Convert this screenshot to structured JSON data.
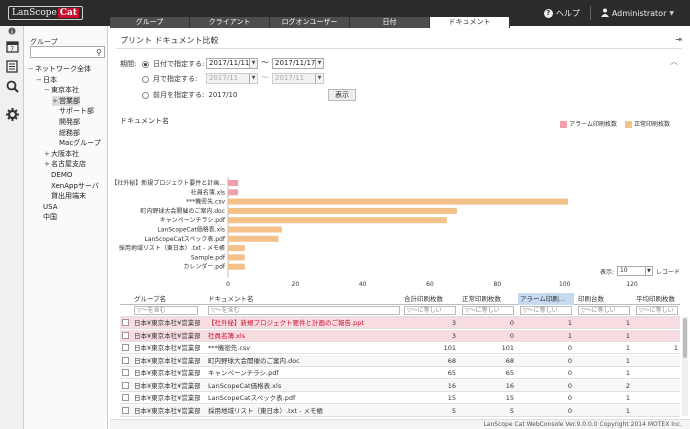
{
  "app": {
    "logo_main": "LanScope",
    "logo_accent": "Cat"
  },
  "topnav": {
    "help": "ヘルプ",
    "user": "Administrator"
  },
  "tabs": [
    "グループ",
    "クライアント",
    "ログオンユーザー",
    "日付",
    "ドキュメント"
  ],
  "active_tab": 4,
  "group_panel": {
    "title": "グループ",
    "tree": [
      {
        "label": "ネットワーク全体",
        "toggle": "−",
        "level": 0
      },
      {
        "label": "日本",
        "toggle": "−",
        "level": 1
      },
      {
        "label": "東京本社",
        "toggle": "−",
        "level": 2
      },
      {
        "label": "営業部",
        "toggle": "+",
        "level": 3,
        "selected": true
      },
      {
        "label": "サポート部",
        "toggle": "",
        "level": 3
      },
      {
        "label": "開発部",
        "toggle": "",
        "level": 3
      },
      {
        "label": "総務部",
        "toggle": "",
        "level": 3
      },
      {
        "label": "Macグループ",
        "toggle": "",
        "level": 3
      },
      {
        "label": "大阪本社",
        "toggle": "+",
        "level": 2
      },
      {
        "label": "名古屋支店",
        "toggle": "+",
        "level": 2
      },
      {
        "label": "DEMO",
        "toggle": "",
        "level": 2
      },
      {
        "label": "XenAppサーバ",
        "toggle": "",
        "level": 2
      },
      {
        "label": "貸出用端末",
        "toggle": "",
        "level": 2
      },
      {
        "label": "USA",
        "toggle": "",
        "level": 1
      },
      {
        "label": "中国",
        "toggle": "",
        "level": 1
      }
    ]
  },
  "main": {
    "title": "プリント ドキュメント比較",
    "period_label": "期間:",
    "opt_date": "日付で指定する:",
    "opt_month": "月で指定する:",
    "opt_prev_month": "前月を指定する:",
    "date_from": "2017/11/11",
    "date_to": "2017/11/17",
    "month_from": "2017/11",
    "month_to": "2017/11",
    "prev_month": "2017/10",
    "display_button": "表示",
    "doc_label": "ドキュメント名",
    "legend_alarm": "アラーム印刷枚数",
    "legend_normal": "正常印刷枚数",
    "page_display_label": "表示:",
    "page_size": "10",
    "record_label": "レコード"
  },
  "colors": {
    "alarm": "#f0a0aa",
    "normal": "#f3c28a",
    "active_tab": "#ffffff"
  },
  "chart_data": {
    "type": "bar",
    "orientation": "horizontal",
    "stacked": true,
    "categories": [
      "【社外秘】新規プロジェクト要件と計画...",
      "社員名簿.xls",
      "***機密先.csv",
      "町内野球大会開催のご案内.doc",
      "キャンペーンチラシ.pdf",
      "LanScopeCat価格表.xls",
      "LanScopeCatスペック表.pdf",
      "採用地域リスト（東日本）.txt - メモ帳",
      "Sample.pdf",
      "カレンダー.pdf"
    ],
    "series": [
      {
        "name": "アラーム印刷枚数",
        "values": [
          3,
          3,
          0,
          0,
          0,
          0,
          0,
          0,
          0,
          0
        ]
      },
      {
        "name": "正常印刷枚数",
        "values": [
          0,
          0,
          101,
          68,
          65,
          16,
          15,
          5,
          5,
          5
        ]
      }
    ],
    "xlim": [
      0,
      120
    ],
    "xticks": [
      0,
      20,
      40,
      60,
      80,
      100,
      120
    ]
  },
  "table": {
    "headers": [
      "グループ名",
      "ドキュメント名",
      "合計印刷枚数",
      "正常印刷枚数",
      "アラーム印刷...",
      "印刷台数",
      "平均印刷枚数"
    ],
    "filters": [
      "▽〜を含む",
      "▽〜を含む",
      "▽〜に等しい",
      "▽〜に等しい",
      "▽〜に等しい",
      "▽〜に等しい",
      "▽〜に等しい"
    ],
    "rows": [
      {
        "group": "日本¥東京本社¥営業部",
        "doc": "【社外秘】新規プロジェクト要件と計画のご報告.ppt",
        "total": "3",
        "normal": "0",
        "alarm": "1",
        "machines": "1",
        "avg": "",
        "alarm_row": true
      },
      {
        "group": "日本¥東京本社¥営業部",
        "doc": "社員名簿.xls",
        "total": "3",
        "normal": "0",
        "alarm": "1",
        "machines": "1",
        "avg": "",
        "alarm_row": true
      },
      {
        "group": "日本¥東京本社¥営業部",
        "doc": "***機密先.csv",
        "total": "101",
        "normal": "101",
        "alarm": "0",
        "machines": "1",
        "avg": "1",
        "alarm_row": false
      },
      {
        "group": "日本¥東京本社¥営業部",
        "doc": "町内野球大会開催のご案内.doc",
        "total": "68",
        "normal": "68",
        "alarm": "0",
        "machines": "1",
        "avg": "",
        "alarm_row": false
      },
      {
        "group": "日本¥東京本社¥営業部",
        "doc": "キャンペーンチラシ.pdf",
        "total": "65",
        "normal": "65",
        "alarm": "0",
        "machines": "1",
        "avg": "",
        "alarm_row": false
      },
      {
        "group": "日本¥東京本社¥営業部",
        "doc": "LanScopeCat価格表.xls",
        "total": "16",
        "normal": "16",
        "alarm": "0",
        "machines": "2",
        "avg": "",
        "alarm_row": false
      },
      {
        "group": "日本¥東京本社¥営業部",
        "doc": "LanScopeCatスペック表.pdf",
        "total": "15",
        "normal": "15",
        "alarm": "0",
        "machines": "1",
        "avg": "",
        "alarm_row": false
      },
      {
        "group": "日本¥東京本社¥営業部",
        "doc": "採用地域リスト（東日本）.txt - メモ帳",
        "total": "5",
        "normal": "5",
        "alarm": "0",
        "machines": "1",
        "avg": "",
        "alarm_row": false
      }
    ]
  },
  "footer": "LanScope Cat WebConsole Ver.9.0.0.0 Copyright 2014 MOTEX Inc."
}
